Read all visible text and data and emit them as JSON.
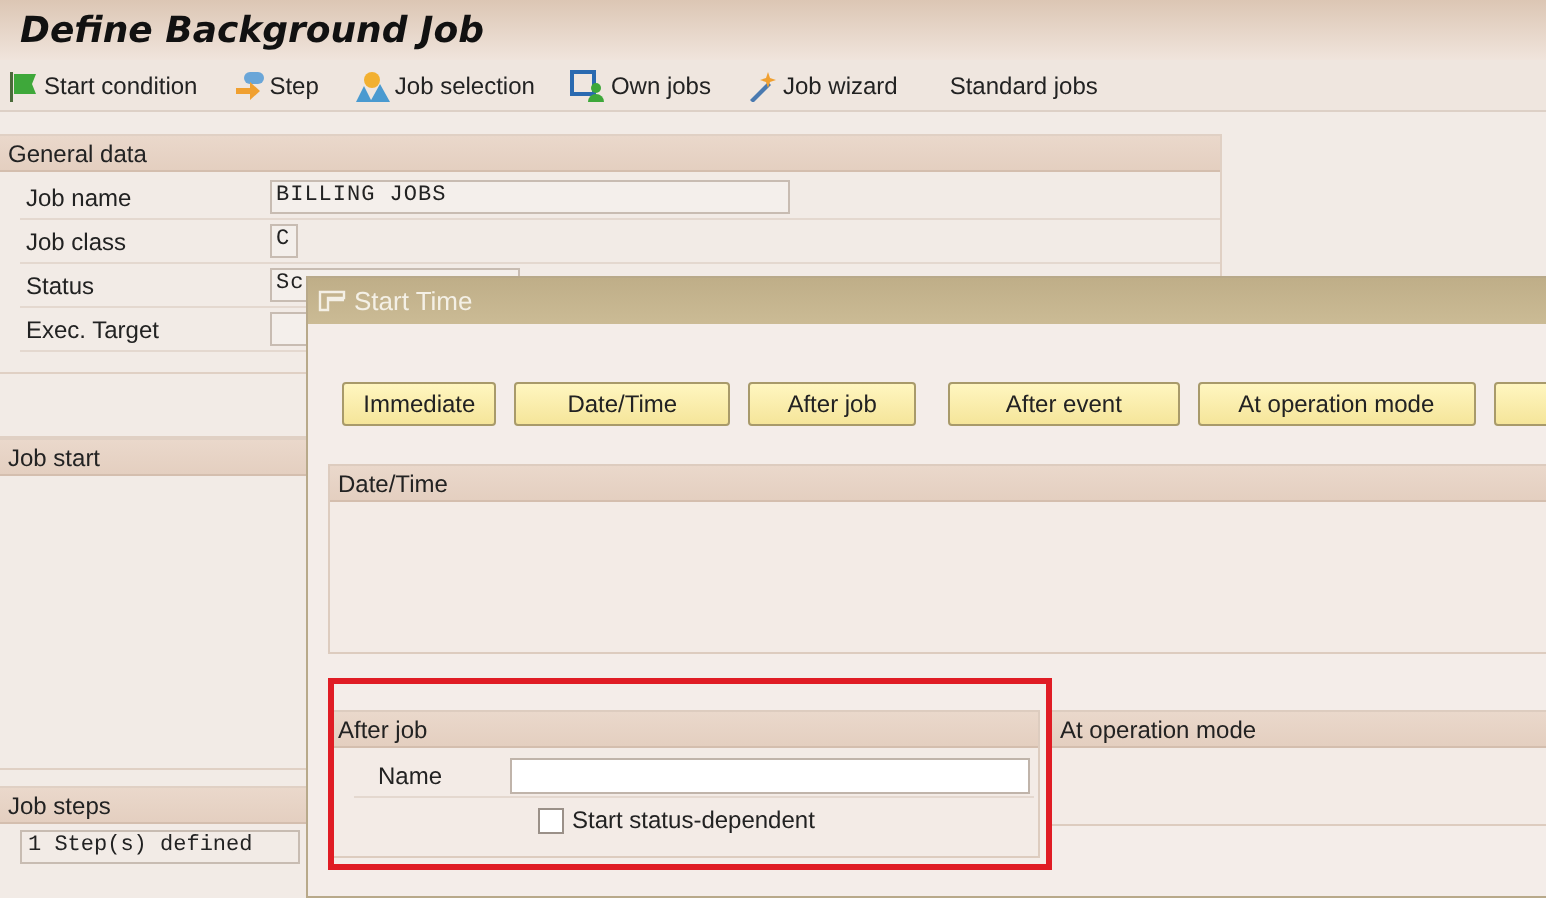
{
  "title": "Define Background Job",
  "toolbar": [
    {
      "label": "Start condition",
      "kind": "flag"
    },
    {
      "label": "Step",
      "kind": "step"
    },
    {
      "label": "Job selection",
      "kind": "selection"
    },
    {
      "label": "Own jobs",
      "kind": "own"
    },
    {
      "label": "Job wizard",
      "kind": "wizard"
    },
    {
      "label": "Standard jobs",
      "kind": "plain"
    }
  ],
  "general_data": {
    "title": "General data",
    "fields": [
      {
        "label": "Job name",
        "value": "BILLING JOBS"
      },
      {
        "label": "Job class",
        "value": "C"
      },
      {
        "label": "Status",
        "value": "Sc"
      },
      {
        "label": "Exec. Target"
      }
    ]
  },
  "job_start": {
    "title": "Job start"
  },
  "job_steps": {
    "title": "Job steps",
    "value": "1 Step(s) defined"
  },
  "dialog": {
    "title": "Start Time",
    "buttons": [
      "Immediate",
      "Date/Time",
      "After job",
      "After event",
      "At operation mode"
    ],
    "date_time_group": {
      "title": "Date/Time"
    },
    "after_job_group": {
      "title": "After job",
      "name_label": "Name",
      "checkbox": {
        "label": "Start status-dependent",
        "checked": false
      }
    },
    "operation_mode_group": {
      "title": "At operation mode"
    }
  }
}
